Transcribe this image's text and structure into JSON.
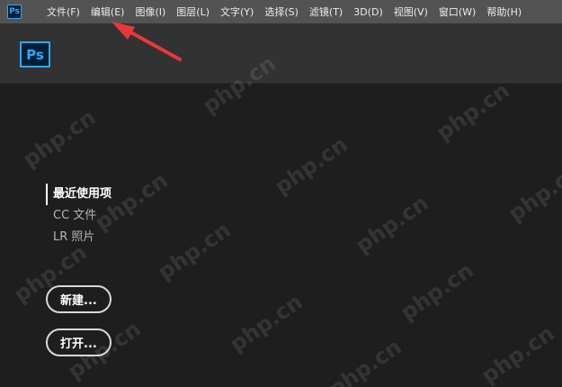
{
  "app_icon": "Ps",
  "menu": [
    {
      "label": "文件(F)"
    },
    {
      "label": "编辑(E)"
    },
    {
      "label": "图像(I)"
    },
    {
      "label": "图层(L)"
    },
    {
      "label": "文字(Y)"
    },
    {
      "label": "选择(S)"
    },
    {
      "label": "滤镜(T)"
    },
    {
      "label": "3D(D)"
    },
    {
      "label": "视图(V)"
    },
    {
      "label": "窗口(W)"
    },
    {
      "label": "帮助(H)"
    }
  ],
  "logo": "Ps",
  "nav": [
    {
      "label": "最近使用项"
    },
    {
      "label": "CC 文件"
    },
    {
      "label": "LR 照片"
    }
  ],
  "buttons": {
    "new": "新建...",
    "open": "打开..."
  },
  "watermark": "php.cn",
  "colors": {
    "menubar": "#535353",
    "header": "#323232",
    "background": "#1e1e1e",
    "accent": "#31a8ff",
    "annotation_arrow": "#e8383d"
  }
}
